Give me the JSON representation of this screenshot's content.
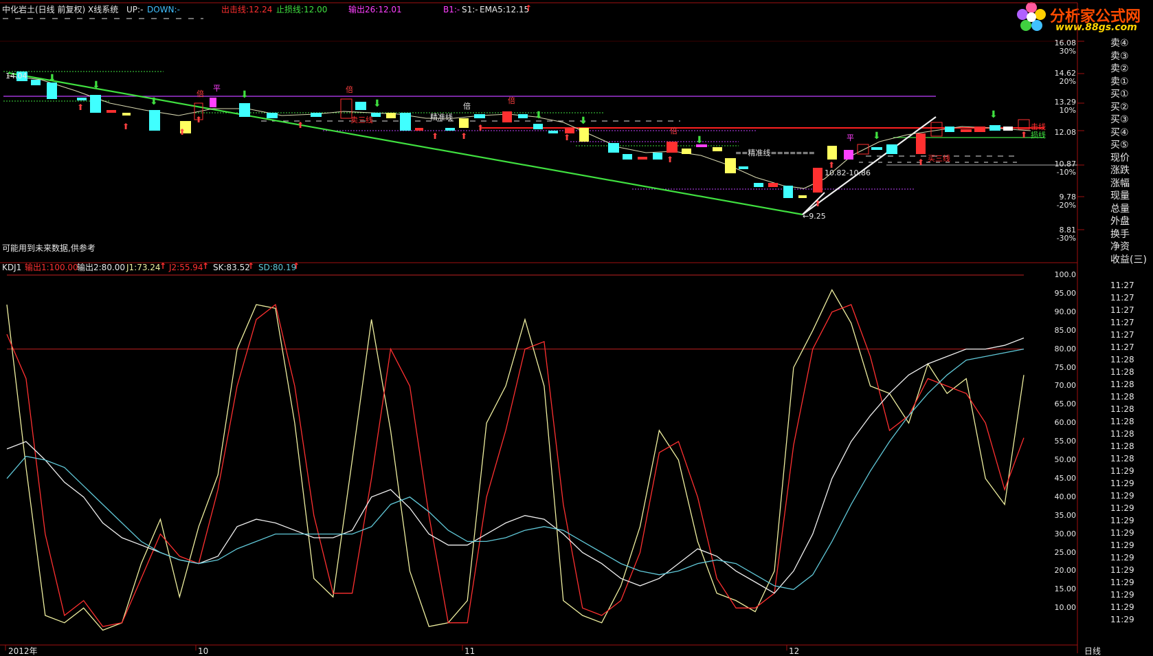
{
  "logo": {
    "title": "分析家公式网",
    "url": "www.88gs.com"
  },
  "header": {
    "title": "中化岩土(日线 前复权) X线系统",
    "up": "UP:-",
    "down": "DOWN:-",
    "exit_line": "出击线:12.24",
    "stop_line": "止损线:12.00",
    "output": "输出26:12.01",
    "b1": "B1:-",
    "s1": "S1:-",
    "ema5": "EMA5:12.15"
  },
  "main_chart": {
    "price_labels": [
      "16.08",
      "14.62",
      "13.29",
      "12.08",
      "10.87",
      "9.78",
      "8.81"
    ],
    "pct_labels": [
      "30%",
      "20%",
      "10%",
      "-10%",
      "-20%",
      "-30%"
    ],
    "note": "可能用到未来数据,供参考",
    "annotations": {
      "low_label": "←9.25",
      "range_label": "10.82-10.86",
      "start_label": "14.04",
      "aim_line_1": "精准线",
      "aim_line_2": "==精准线=======",
      "exit_tag": "击线",
      "stop_tag": "损线",
      "bei": "倍",
      "ping": "平",
      "sell_line": "卖三线",
      "buy_line": "买三线"
    }
  },
  "sidebar": {
    "items": [
      "卖④",
      "卖③",
      "卖②",
      "卖①",
      "买①",
      "买②",
      "买③",
      "买④",
      "买⑤",
      "现价",
      "涨跌",
      "涨幅",
      "现量",
      "总量",
      "外盘",
      "换手",
      "净资",
      "收益(三)"
    ],
    "times": [
      "11:27",
      "11:27",
      "11:27",
      "11:27",
      "11:27",
      "11:27",
      "11:28",
      "11:28",
      "11:28",
      "11:28",
      "11:28",
      "11:28",
      "11:28",
      "11:28",
      "11:28",
      "11:29",
      "11:29",
      "11:29",
      "11:29",
      "11:29",
      "11:29",
      "11:29",
      "11:29",
      "11:29",
      "11:29",
      "11:29",
      "11:29",
      "11:29"
    ]
  },
  "kdj": {
    "name": "KDJ1",
    "out1": "输出1:100.00",
    "out2": "输出2:80.00",
    "j1": "J1:73.24",
    "j2": "J2:55.94",
    "sk": "SK:83.52",
    "sd": "SD:80.19",
    "y_labels": [
      "100.0",
      "95.00",
      "90.00",
      "85.00",
      "80.00",
      "75.00",
      "70.00",
      "65.00",
      "60.00",
      "55.00",
      "50.00",
      "45.00",
      "40.00",
      "35.00",
      "30.00",
      "25.00",
      "20.00",
      "15.00",
      "10.00"
    ]
  },
  "x_axis": {
    "labels": [
      "2012年",
      "10",
      "11",
      "12"
    ],
    "period": "日线"
  },
  "colors": {
    "yellow_line": "#f0f0a0",
    "red_line": "#ff3030",
    "cyan_line": "#60c8d8",
    "white_line": "#f0f0f0",
    "green_trend": "#40e040",
    "up_candle": "#ff3030",
    "down_candle": "#40ffff"
  },
  "chart_data": {
    "type": "line",
    "title": "KDJ1",
    "series": [
      {
        "name": "J1",
        "values": [
          92,
          48,
          8,
          6,
          10,
          4,
          6,
          22,
          34,
          13,
          32,
          46,
          80,
          92,
          91,
          60,
          18,
          13,
          50,
          88,
          58,
          20,
          5,
          6,
          12,
          60,
          70,
          88,
          70,
          12,
          8,
          6,
          16,
          32,
          58,
          50,
          28,
          14,
          12,
          9,
          20,
          75,
          85,
          96,
          87,
          70,
          68,
          60,
          76,
          68,
          72,
          45,
          38,
          73
        ]
      },
      {
        "name": "J2",
        "values": [
          84,
          72,
          30,
          8,
          12,
          5,
          6,
          18,
          30,
          24,
          22,
          42,
          70,
          88,
          92,
          70,
          35,
          14,
          14,
          45,
          80,
          70,
          35,
          6,
          6,
          40,
          58,
          80,
          82,
          38,
          10,
          8,
          12,
          25,
          52,
          55,
          40,
          18,
          10,
          10,
          14,
          54,
          80,
          90,
          92,
          78,
          58,
          62,
          72,
          70,
          68,
          60,
          42,
          56
        ]
      },
      {
        "name": "SK",
        "values": [
          53,
          55,
          50,
          44,
          40,
          33,
          29,
          27,
          25,
          23,
          22,
          24,
          32,
          34,
          33,
          31,
          29,
          29,
          31,
          40,
          42,
          37,
          30,
          27,
          27,
          30,
          33,
          35,
          34,
          30,
          25,
          22,
          18,
          16,
          18,
          22,
          26,
          24,
          20,
          17,
          14,
          20,
          30,
          45,
          55,
          62,
          68,
          73,
          76,
          78,
          80,
          80,
          81,
          83
        ]
      },
      {
        "name": "SD",
        "values": [
          45,
          51,
          50,
          48,
          43,
          38,
          33,
          28,
          25,
          23,
          22,
          23,
          26,
          28,
          30,
          30,
          30,
          30,
          30,
          32,
          38,
          40,
          36,
          31,
          28,
          28,
          29,
          31,
          32,
          31,
          28,
          25,
          22,
          20,
          19,
          20,
          22,
          23,
          22,
          19,
          16,
          15,
          19,
          28,
          38,
          47,
          55,
          62,
          68,
          73,
          77,
          78,
          79,
          80
        ]
      }
    ],
    "ylim": [
      5,
      100
    ],
    "reference_lines": [
      100,
      80
    ]
  }
}
